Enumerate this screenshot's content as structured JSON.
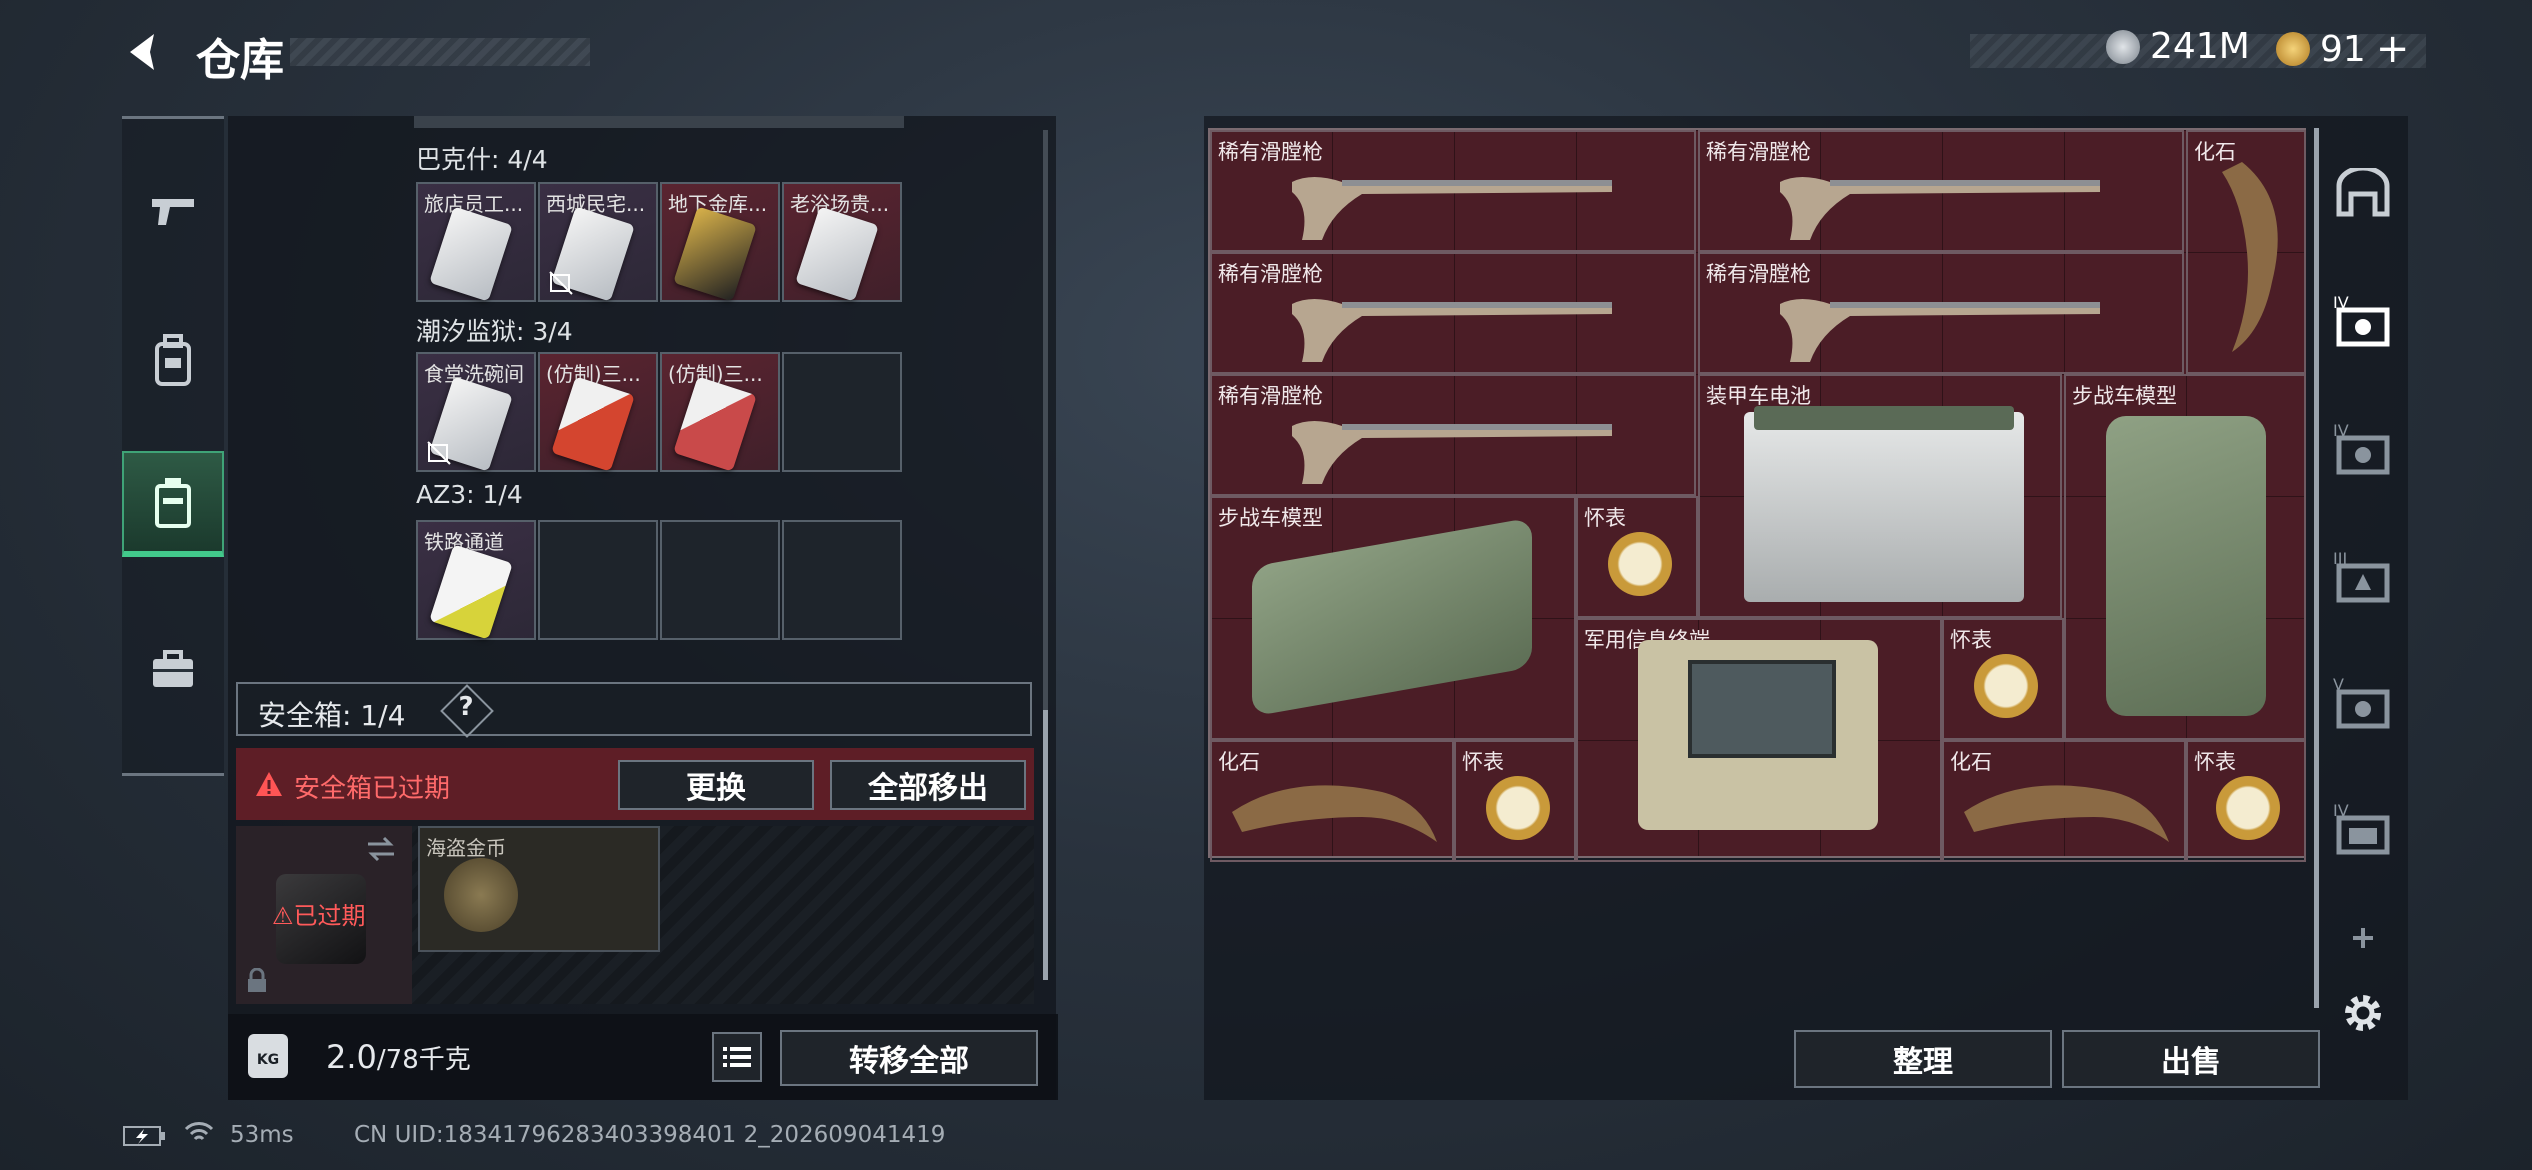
{
  "header": {
    "title": "仓库",
    "currency1": "241M",
    "currency2": "91",
    "plus": "+"
  },
  "left_sections": [
    {
      "label": "巴克什: 4/4",
      "slots": [
        "旅店员工...",
        "西城民宅...",
        "地下金库...",
        "老浴场贵..."
      ]
    },
    {
      "label": "潮汐监狱: 3/4",
      "slots": [
        "食堂洗碗间",
        "(仿制)三...",
        "(仿制)三...",
        ""
      ]
    },
    {
      "label": "AZ3: 1/4",
      "slots": [
        "铁路通道",
        "",
        "",
        ""
      ]
    }
  ],
  "safebox": {
    "label": "安全箱:  1/4",
    "help": "?"
  },
  "expired": {
    "warning": "安全箱已过期",
    "replace": "更换",
    "move_all_out": "全部移出",
    "expired_tag": "已过期",
    "coin_item": "海盗金币"
  },
  "bottom": {
    "weight_current": "2.0",
    "weight_max": "/78千克",
    "kg": "KG",
    "transfer_all": "转移全部"
  },
  "items": {
    "gun": "稀有滑膛枪",
    "fossil": "化石",
    "battery": "装甲车电池",
    "ifv": "步战车模型",
    "watch": "怀表",
    "terminal": "军用信息终端"
  },
  "right_buttons": {
    "sort": "整理",
    "sell": "出售"
  },
  "status": {
    "ping": "53ms",
    "uid": "CN UID:18341796283403398401 2_202609041419"
  },
  "colors": {
    "accent_green": "#42c98b",
    "danger_red": "#e24a4a",
    "grid_red": "#4b1d26"
  }
}
